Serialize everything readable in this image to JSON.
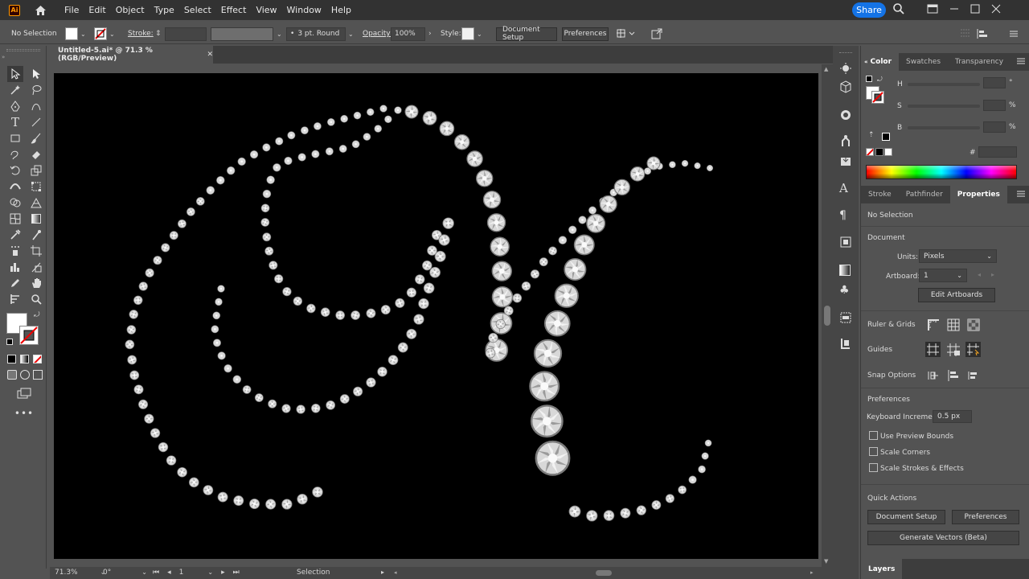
{
  "app": {
    "logo_text": "Ai",
    "menus": [
      "File",
      "Edit",
      "Object",
      "Type",
      "Select",
      "Effect",
      "View",
      "Window",
      "Help"
    ],
    "share_label": "Share"
  },
  "control_bar": {
    "selection_status": "No Selection",
    "stroke_label": "Stroke:",
    "brush_label": "3 pt. Round",
    "opacity_label": "Opacity:",
    "opacity_value": "100%",
    "style_label": "Style:",
    "document_setup_label": "Document Setup",
    "preferences_label": "Preferences"
  },
  "document": {
    "tab_title": "Untitled-5.ai* @ 71.3 % (RGB/Preview)",
    "close_glyph": "✕"
  },
  "status_bar": {
    "zoom": "71.3%",
    "rotation": "0°",
    "artboard_number": "1",
    "tool_name": "Selection"
  },
  "color_panel": {
    "tabs": [
      "Color",
      "Swatches",
      "Transparency"
    ],
    "channels": [
      {
        "label": "H",
        "unit": "°"
      },
      {
        "label": "S",
        "unit": "%"
      },
      {
        "label": "B",
        "unit": "%"
      }
    ],
    "hex_label": "#"
  },
  "properties_panel": {
    "tabs": [
      "Stroke",
      "Pathfinder",
      "Properties"
    ],
    "no_selection": "No Selection",
    "document_heading": "Document",
    "units_label": "Units:",
    "units_value": "Pixels",
    "artboard_label": "Artboard:",
    "artboard_value": "1",
    "edit_artboards_label": "Edit Artboards",
    "ruler_grids_label": "Ruler & Grids",
    "guides_label": "Guides",
    "snap_options_label": "Snap Options",
    "preferences_heading": "Preferences",
    "keyboard_increment_label": "Keyboard Increment:",
    "keyboard_increment_value": "0.5 px",
    "use_preview_bounds": "Use Preview Bounds",
    "scale_corners": "Scale Corners",
    "scale_strokes_effects": "Scale Strokes & Effects",
    "quick_actions_heading": "Quick Actions",
    "document_setup_label": "Document Setup",
    "preferences_label": "Preferences",
    "generate_vectors_label": "Generate Vectors (Beta)"
  },
  "layers_panel": {
    "tab_label": "Layers"
  },
  "colors": {
    "accent": "#1473e6",
    "app_bg": "#535353",
    "menubar_bg": "#323232",
    "artboard_bg": "#000000",
    "gem": "#d8d8d8"
  }
}
